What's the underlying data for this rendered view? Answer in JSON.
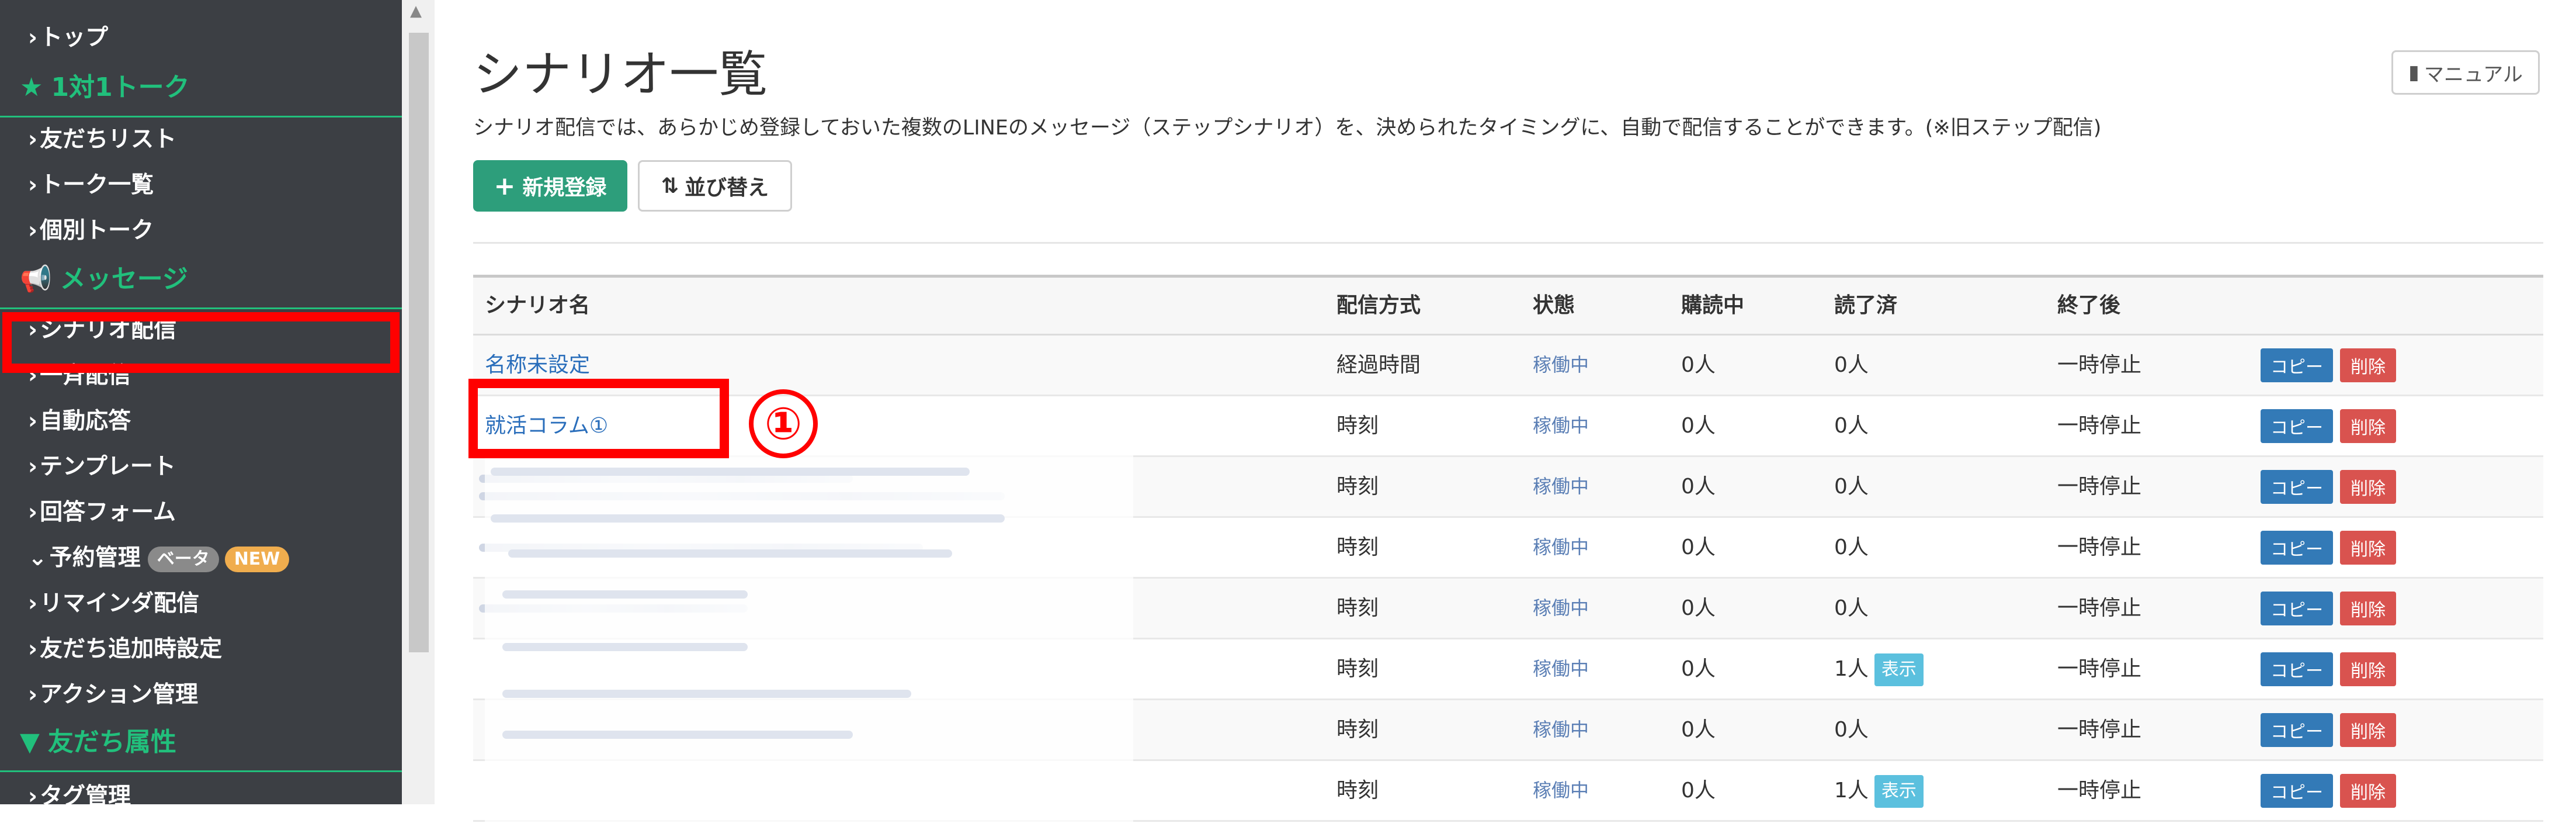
{
  "sidebar": {
    "top_item": "トップ",
    "section_talk": "1対1トーク",
    "talk_items": [
      "友だちリスト",
      "トーク一覧",
      "個別トーク"
    ],
    "section_message": "メッセージ",
    "message_items": [
      "シナリオ配信",
      "一斉配信",
      "自動応答",
      "テンプレート",
      "回答フォーム"
    ],
    "reservation": {
      "label": "予約管理",
      "badge_beta": "ベータ",
      "badge_new": "NEW"
    },
    "more_items": [
      "リマインダ配信",
      "友だち追加時設定",
      "アクション管理"
    ],
    "section_attr": "友だち属性",
    "attr_items": [
      "タグ管理"
    ]
  },
  "header": {
    "title": "シナリオ一覧",
    "manual_label": "マニュアル",
    "description": "シナリオ配信では、あらかじめ登録しておいた複数のLINEのメッセージ（ステップシナリオ）を、決められたタイミングに、自動で配信することができます。(※旧ステップ配信)"
  },
  "toolbar": {
    "new_label": "新規登録",
    "sort_label": "並び替え"
  },
  "table": {
    "columns": [
      "シナリオ名",
      "配信方式",
      "状態",
      "購読中",
      "読了済",
      "終了後"
    ],
    "rows": [
      {
        "name": "名称未設定",
        "method": "経過時間",
        "status": "稼働中",
        "subscribing": "0人",
        "read": "0人",
        "read_badge": "",
        "after": "一時停止"
      },
      {
        "name": "就活コラム①",
        "method": "時刻",
        "status": "稼働中",
        "subscribing": "0人",
        "read": "0人",
        "read_badge": "",
        "after": "一時停止"
      },
      {
        "name": "",
        "method": "時刻",
        "status": "稼働中",
        "subscribing": "0人",
        "read": "0人",
        "read_badge": "",
        "after": "一時停止"
      },
      {
        "name": "",
        "method": "時刻",
        "status": "稼働中",
        "subscribing": "0人",
        "read": "0人",
        "read_badge": "",
        "after": "一時停止"
      },
      {
        "name": "",
        "method": "時刻",
        "status": "稼働中",
        "subscribing": "0人",
        "read": "0人",
        "read_badge": "",
        "after": "一時停止"
      },
      {
        "name": "",
        "method": "時刻",
        "status": "稼働中",
        "subscribing": "0人",
        "read": "1人",
        "read_badge": "表示",
        "after": "一時停止"
      },
      {
        "name": "",
        "method": "時刻",
        "status": "稼働中",
        "subscribing": "0人",
        "read": "0人",
        "read_badge": "",
        "after": "一時停止"
      },
      {
        "name": "",
        "method": "時刻",
        "status": "稼働中",
        "subscribing": "0人",
        "read": "1人",
        "read_badge": "表示",
        "after": "一時停止"
      }
    ],
    "copy_label": "コピー",
    "delete_label": "削除"
  },
  "annotation": {
    "step_number": "①"
  },
  "colors": {
    "sidebar_bg": "#3c3f44",
    "accent_green": "#21c07c",
    "primary_blue": "#337ab7",
    "danger_red": "#d9534f",
    "highlight_red": "#ff0000"
  }
}
